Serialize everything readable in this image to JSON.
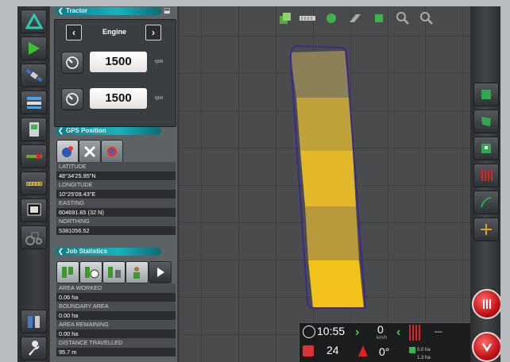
{
  "tractor_panel": {
    "title": "Tractor",
    "engine_label": "Engine",
    "rows": [
      {
        "value": "1500",
        "unit": "rpm"
      },
      {
        "value": "1500",
        "unit": "rpm"
      }
    ]
  },
  "gps_panel": {
    "title": "GPS Position",
    "fields": [
      {
        "label": "LATITUDE",
        "value": "48°34'25.85\"N"
      },
      {
        "label": "LONGITUDE",
        "value": "10°25'09.43\"E"
      },
      {
        "label": "EASTING",
        "value": "604691.65 (32 N)"
      },
      {
        "label": "NORTHING",
        "value": "5381056.52"
      }
    ]
  },
  "job_panel": {
    "title": "Job Statistics",
    "fields": [
      {
        "label": "AREA WORKED",
        "value": "0.06 ha"
      },
      {
        "label": "BOUNDARY AREA",
        "value": "0.00 ha"
      },
      {
        "label": "AREA REMAINING",
        "value": "0.00 ha"
      },
      {
        "label": "DISTANCE TRAVELLED",
        "value": "95.7 m"
      }
    ]
  },
  "status_bar": {
    "time": "10:55",
    "date": "24",
    "speed": "0",
    "speed_unit": "km/h",
    "heading": "0°",
    "dashes": "---",
    "area1": "0.0 ha",
    "area2": "1.3 ha"
  },
  "colors": {
    "accent": "#17b3bd",
    "coverage": "#f2c21a",
    "boundary": "#3a2a8c",
    "alert": "#c01216"
  }
}
